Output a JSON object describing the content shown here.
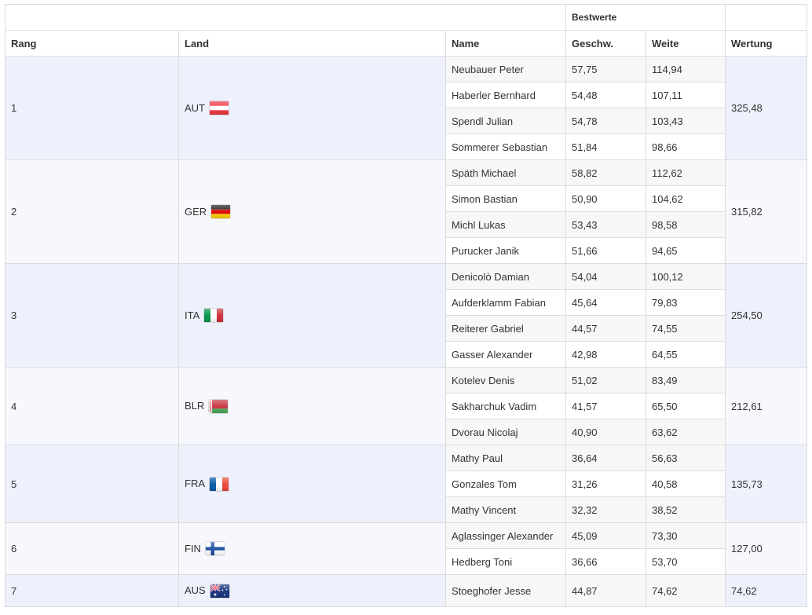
{
  "header": {
    "group_label": "Bestwerte",
    "columns": {
      "rang": "Rang",
      "land": "Land",
      "name": "Name",
      "speed": "Geschw.",
      "distance": "Weite",
      "score": "Wertung"
    }
  },
  "teams": [
    {
      "rank": "1",
      "country": "AUT",
      "flag_icon": "austria-flag-icon",
      "score": "325,48",
      "athletes": [
        {
          "name": "Neubauer Peter",
          "speed": "57,75",
          "distance": "114,94"
        },
        {
          "name": "Haberler Bernhard",
          "speed": "54,48",
          "distance": "107,11"
        },
        {
          "name": "Spendl Julian",
          "speed": "54,78",
          "distance": "103,43"
        },
        {
          "name": "Sommerer Sebastian",
          "speed": "51,84",
          "distance": "98,66"
        }
      ]
    },
    {
      "rank": "2",
      "country": "GER",
      "flag_icon": "germany-flag-icon",
      "score": "315,82",
      "athletes": [
        {
          "name": "Späth Michael",
          "speed": "58,82",
          "distance": "112,62"
        },
        {
          "name": "Simon Bastian",
          "speed": "50,90",
          "distance": "104,62"
        },
        {
          "name": "Michl Lukas",
          "speed": "53,43",
          "distance": "98,58"
        },
        {
          "name": "Purucker Janik",
          "speed": "51,66",
          "distance": "94,65"
        }
      ]
    },
    {
      "rank": "3",
      "country": "ITA",
      "flag_icon": "italy-flag-icon",
      "score": "254,50",
      "athletes": [
        {
          "name": "Denicolò Damian",
          "speed": "54,04",
          "distance": "100,12"
        },
        {
          "name": "Aufderklamm Fabian",
          "speed": "45,64",
          "distance": "79,83"
        },
        {
          "name": "Reiterer Gabriel",
          "speed": "44,57",
          "distance": "74,55"
        },
        {
          "name": "Gasser Alexander",
          "speed": "42,98",
          "distance": "64,55"
        }
      ]
    },
    {
      "rank": "4",
      "country": "BLR",
      "flag_icon": "belarus-flag-icon",
      "score": "212,61",
      "athletes": [
        {
          "name": "Kotelev Denis",
          "speed": "51,02",
          "distance": "83,49"
        },
        {
          "name": "Sakharchuk Vadim",
          "speed": "41,57",
          "distance": "65,50"
        },
        {
          "name": "Dvorau Nicolaj",
          "speed": "40,90",
          "distance": "63,62"
        }
      ]
    },
    {
      "rank": "5",
      "country": "FRA",
      "flag_icon": "france-flag-icon",
      "score": "135,73",
      "athletes": [
        {
          "name": "Mathy Paul",
          "speed": "36,64",
          "distance": "56,63"
        },
        {
          "name": "Gonzales Tom",
          "speed": "31,26",
          "distance": "40,58"
        },
        {
          "name": "Mathy Vincent",
          "speed": "32,32",
          "distance": "38,52"
        }
      ]
    },
    {
      "rank": "6",
      "country": "FIN",
      "flag_icon": "finland-flag-icon",
      "score": "127,00",
      "athletes": [
        {
          "name": "Aglassinger Alexander",
          "speed": "45,09",
          "distance": "73,30"
        },
        {
          "name": "Hedberg Toni",
          "speed": "36,66",
          "distance": "53,70"
        }
      ]
    },
    {
      "rank": "7",
      "country": "AUS",
      "flag_icon": "australia-flag-icon",
      "score": "74,62",
      "athletes": [
        {
          "name": "Stoeghofer Jesse",
          "speed": "44,87",
          "distance": "74,62"
        }
      ]
    }
  ]
}
